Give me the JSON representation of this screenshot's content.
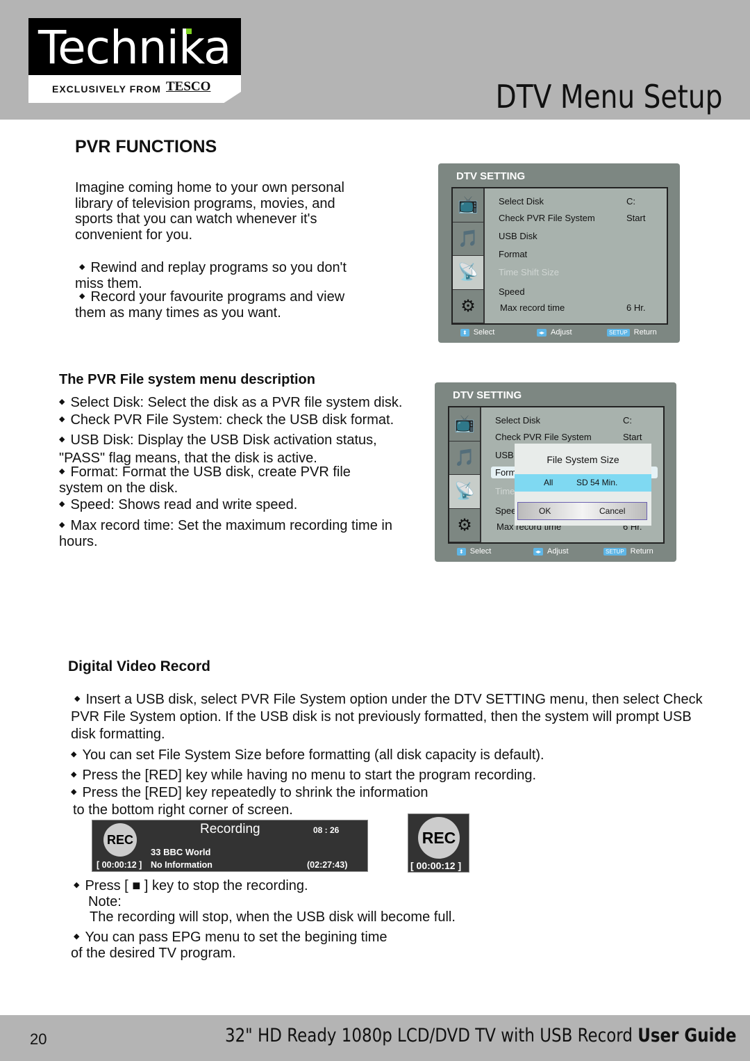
{
  "header": {
    "logo_text": "Technika",
    "logo_tagline": "EXCLUSIVELY FROM",
    "logo_brand": "TESCO",
    "title": "DTV Menu Setup"
  },
  "pvr": {
    "heading": "PVR FUNCTIONS",
    "intro": "Imagine coming home to your own personal library of television programs, movies, and sports that you can watch whenever it's convenient for you.",
    "bullets": [
      "Rewind and replay programs so you don't miss them.",
      "Record your favourite programs and view them as many times as you want."
    ]
  },
  "filesys": {
    "heading": "The PVR File system menu description",
    "bullets": [
      "Select Disk: Select the disk as a PVR file system disk.",
      "Check PVR File System: check the USB disk format.",
      "USB Disk: Display the USB Disk activation status, \"PASS\" flag means, that the disk is active.",
      "Format: Format the USB disk, create PVR file system on the disk.",
      "Speed: Shows read and write speed.",
      "Max record time: Set the maximum recording time in hours."
    ]
  },
  "menu": {
    "title": "DTV SETTING",
    "rows": [
      "Select Disk",
      "Check PVR File System",
      "USB Disk",
      "Format",
      "Time Shift Size",
      "Speed",
      "Max record time"
    ],
    "values": {
      "select_disk": "C:",
      "check": "Start",
      "max": "6 Hr."
    },
    "footer": {
      "select": "Select",
      "adjust": "Adjust",
      "setup_key": "SETUP",
      "return": "Return"
    },
    "icons": [
      "tv-icon",
      "audio-icon",
      "satellite-icon",
      "settings-icon"
    ]
  },
  "dialog": {
    "title": "File System Size",
    "option_left": "All",
    "option_right": "SD 54 Min.",
    "ok": "OK",
    "cancel": "Cancel",
    "truncated": {
      "usb": "USB",
      "format": "Form",
      "time": "Time",
      "speed": "Spee"
    }
  },
  "dvr": {
    "heading": "Digital Video Record",
    "bullets": [
      "Insert a USB disk, select PVR File System option under the DTV SETTING menu, then select Check PVR File System option. If the USB disk is not previously formatted, then the system will prompt USB disk formatting.",
      "You can set File System Size before formatting (all disk capacity is default).",
      "Press the [RED] key while having no menu to start the program recording.",
      "Press the [RED] key repeatedly to shrink the information"
    ],
    "shrink_cont": "to the bottom right corner of screen.",
    "stop": "Press [ ■ ] key to stop the recording.",
    "note_label": "Note:",
    "note": "The recording will stop, when the USB disk will become full.",
    "epg": "You can pass EPG menu to set the begining time",
    "epg_cont": "of the desired TV program."
  },
  "recbar": {
    "badge": "REC",
    "title": "Recording",
    "clock": "08 : 26",
    "channel": "33 BBC World",
    "elapsed": "[ 00:00:12 ]",
    "info": "No Information",
    "remaining": "(02:27:43)"
  },
  "recmini": {
    "badge": "REC",
    "elapsed": "[ 00:00:12 ]"
  },
  "footer": {
    "page": "20",
    "product": "32\" HD Ready 1080p LCD/DVD TV with USB Record",
    "guide": "User Guide"
  }
}
